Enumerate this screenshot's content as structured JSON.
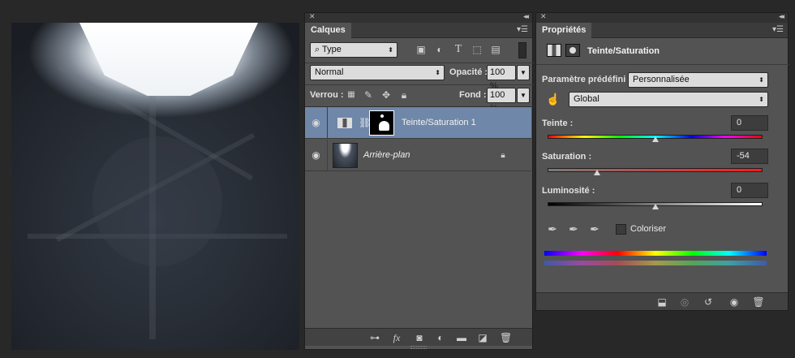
{
  "layers_panel": {
    "tab": "Calques",
    "filter_kind": "Type",
    "blend_mode": "Normal",
    "opacity_label": "Opacité :",
    "opacity_value": "100 %",
    "lock_label": "Verrou :",
    "fill_label": "Fond :",
    "fill_value": "100 %",
    "layers": [
      {
        "name": "Teinte/Saturation 1",
        "selected": true
      },
      {
        "name": "Arrière-plan",
        "selected": false
      }
    ],
    "bottom_icons": [
      "link-icon",
      "fx-icon",
      "mask-icon",
      "adjustment-icon",
      "folder-icon",
      "new-layer-icon",
      "trash-icon"
    ],
    "fx_label": "fx"
  },
  "properties_panel": {
    "tab": "Propriétés",
    "title": "Teinte/Saturation",
    "preset_label": "Paramètre prédéfini :",
    "preset_value": "Personnalisée",
    "channel_value": "Global",
    "hue_label": "Teinte :",
    "hue_value": "0",
    "hue_level_fraction": 0.5,
    "saturation_label": "Saturation :",
    "saturation_value": "-54",
    "saturation_level_fraction": 0.23,
    "lightness_label": "Luminosité :",
    "lightness_value": "0",
    "lightness_level_fraction": 0.5,
    "colorize_label": "Coloriser",
    "colorize_checked": false
  },
  "colors": {
    "panel_bg": "#535353",
    "selected_layer": "#6f87a8"
  }
}
